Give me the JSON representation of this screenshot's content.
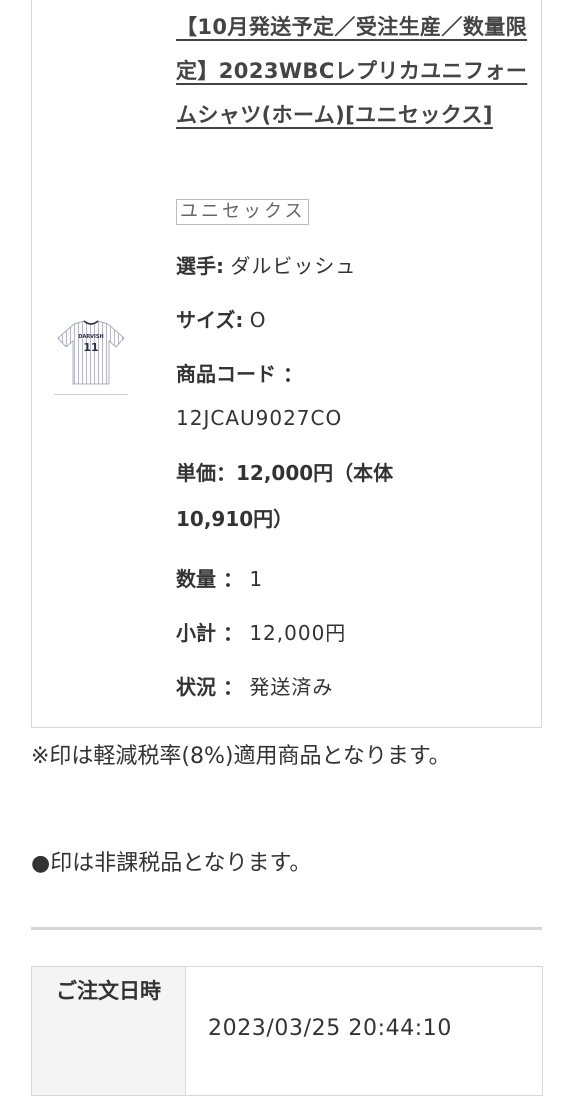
{
  "item": {
    "title": "【10月発送予定／受注生産／数量限定】2023WBCレプリカユニフォームシャツ(ホーム)[ユニセックス]",
    "thumbnail": {
      "icon": "jersey-image",
      "number_text": "11",
      "name_text": "DARVISH"
    },
    "variant_tag": "ユニセックス",
    "player": {
      "label": "選手:",
      "value": "ダルビッシュ"
    },
    "size": {
      "label": "サイズ:",
      "value": "O"
    },
    "product_code": {
      "label": "商品コード ：",
      "value": "12JCAU9027CO"
    },
    "unit_price": "単価：12,000円（本体10,910円）",
    "quantity": {
      "label": "数量 ：",
      "value": "1"
    },
    "subtotal": {
      "label": "小計 ：",
      "value": "12,000円"
    },
    "status": {
      "label": "状況 ：",
      "value": "発送済み"
    }
  },
  "notes": {
    "reduced_tax": "※印は軽減税率(8%)適用商品となります。",
    "tax_exempt": "●印は非課税品となります。"
  },
  "order_info": {
    "date_label": "ご注文日時",
    "date_value": "2023/03/25 20:44:10"
  },
  "colors": {
    "text": "#333333",
    "border": "#d8d8d8",
    "header_bg": "#f4f4f4"
  }
}
